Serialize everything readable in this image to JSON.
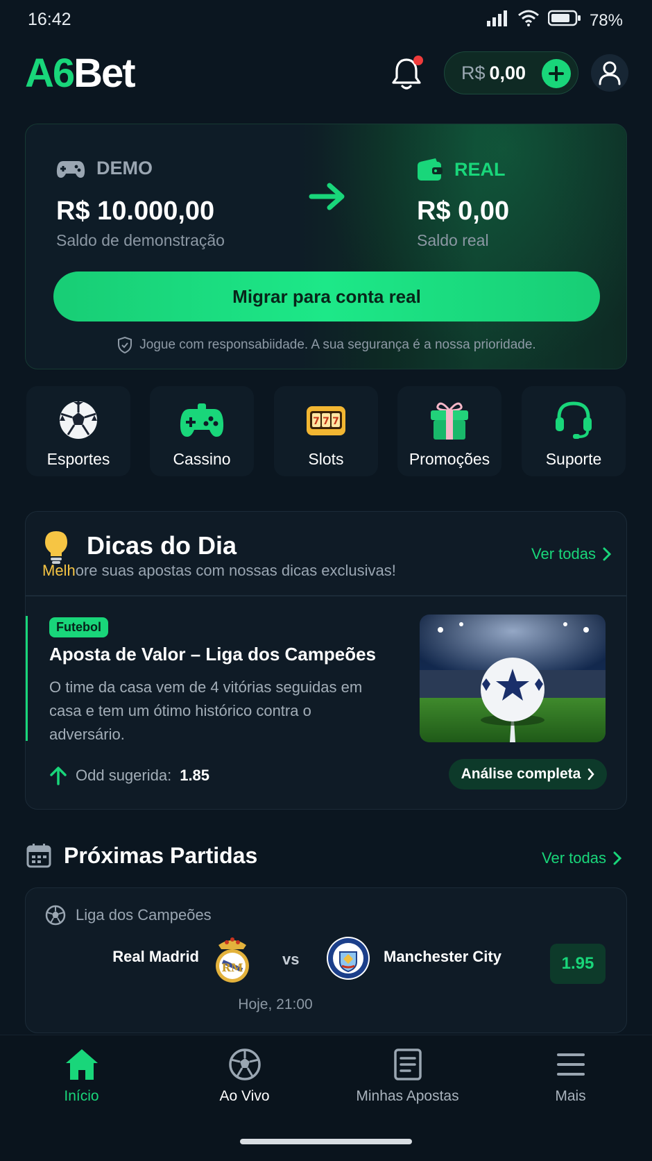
{
  "status": {
    "time": "16:42",
    "battery": "78%"
  },
  "header": {
    "logo_a": "A6",
    "logo_b": "Bet",
    "balance_currency": "R$",
    "balance_amount": "0,00"
  },
  "demo_card": {
    "demo_label": "DEMO",
    "demo_amount": "R$ 10.000,00",
    "demo_sub": "Saldo de demonstração",
    "real_label": "REAL",
    "real_amount": "R$ 0,00",
    "real_sub": "Saldo real",
    "migrate_label": "Migrar para conta real",
    "safety_text": "Jogue com responsabiidade. A sua segurança é a nossa prioridade."
  },
  "categories": [
    {
      "label": "Esportes",
      "icon": "soccer-ball-icon"
    },
    {
      "label": "Cassino",
      "icon": "gamepad-icon"
    },
    {
      "label": "Slots",
      "icon": "slot-machine-icon"
    },
    {
      "label": "Promoções",
      "icon": "gift-icon"
    },
    {
      "label": "Suporte",
      "icon": "headset-icon"
    }
  ],
  "tips": {
    "title": "Dicas do Dia",
    "subtitle_hl": "Melh",
    "subtitle_rest": "ore suas apostas com nossas dicas exclusivas!",
    "see_all": "Ver todas",
    "tag": "Futebol",
    "tip_title": "Aposta de Valor – Liga dos Campeões",
    "tip_desc": "O time da casa vem de 4 vitórias seguidas em casa e tem um ótimo histórico contra o adversário.",
    "odd_label": "Odd sugerida:",
    "odd_value": "1.85",
    "analysis_label": "Análise completa"
  },
  "upcoming": {
    "title": "Próximas Partidas",
    "see_all": "Ver todas",
    "match": {
      "league": "Liga dos Campeões",
      "home": "Real Madrid",
      "vs": "vs",
      "away": "Manchester City",
      "odd": "1.95",
      "time": "Hoje, 21:00"
    }
  },
  "bottom_nav": [
    {
      "label": "Início",
      "icon": "home-icon"
    },
    {
      "label": "Ao Vivo",
      "icon": "live-ball-icon"
    },
    {
      "label": "Minhas Apostas",
      "icon": "bets-list-icon"
    },
    {
      "label": "Mais",
      "icon": "menu-icon"
    }
  ],
  "colors": {
    "accent": "#19d67a",
    "background": "#0b1620",
    "card": "#0f1b26",
    "notification": "#ef3b3b"
  }
}
